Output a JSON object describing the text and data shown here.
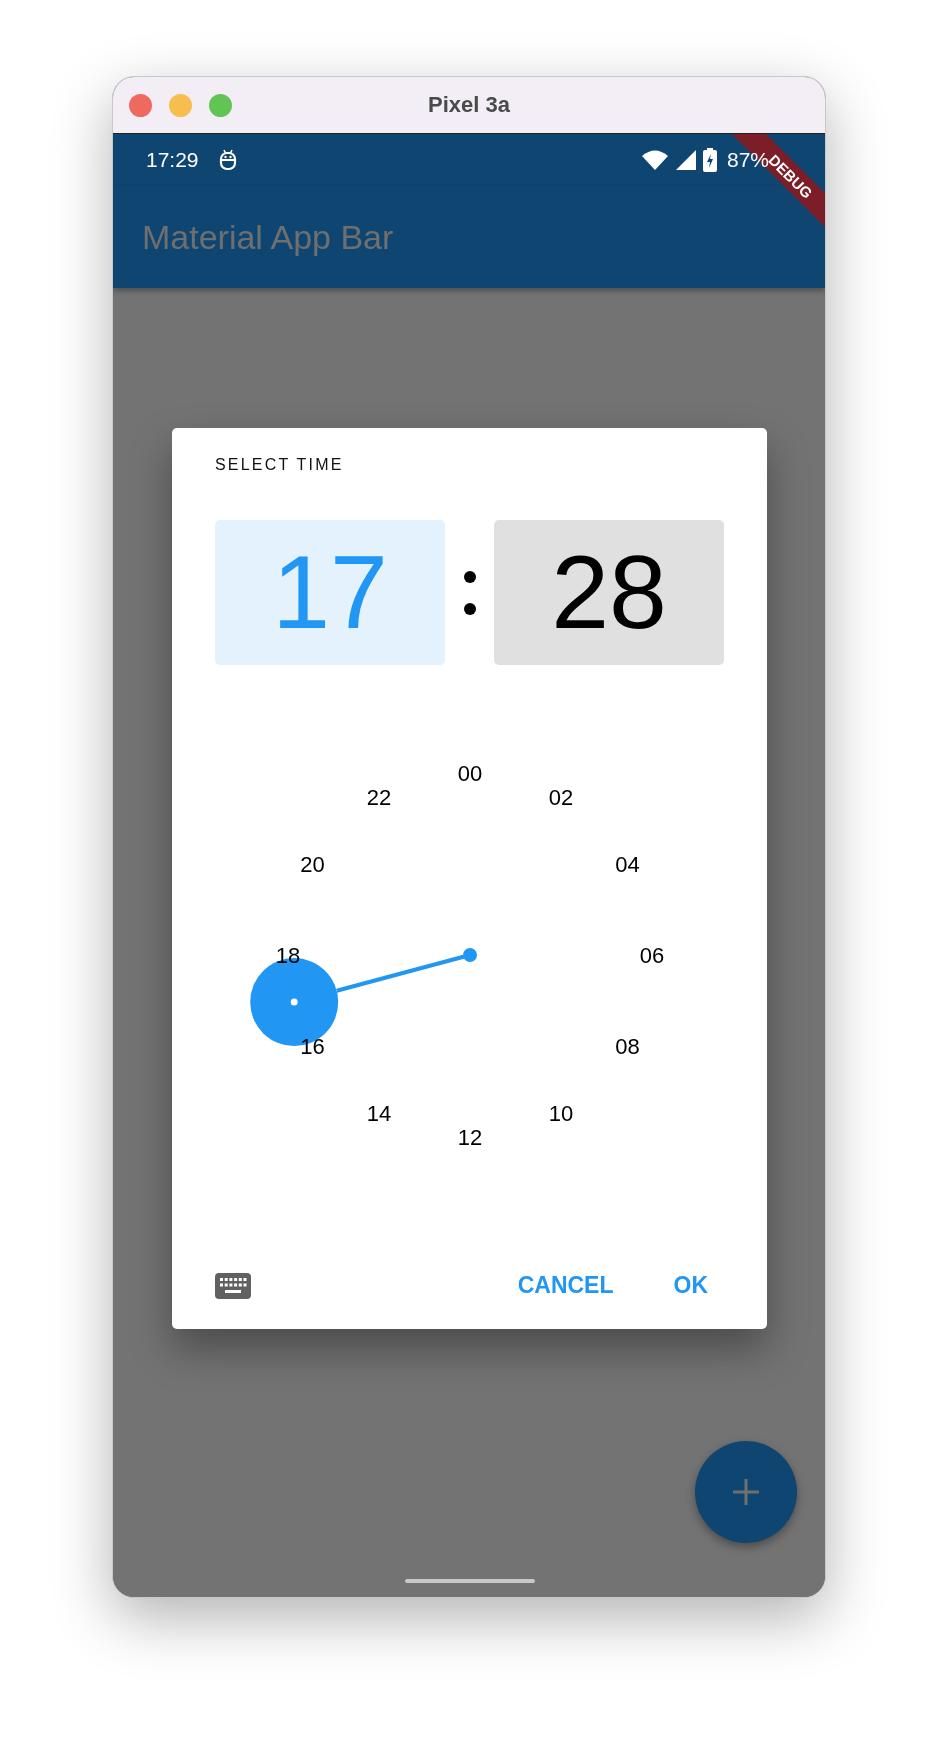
{
  "window": {
    "title": "Pixel 3a"
  },
  "status_bar": {
    "time": "17:29",
    "battery": "87%"
  },
  "debug_banner": {
    "label": "DEBUG"
  },
  "app_bar": {
    "title": "Material App Bar"
  },
  "dialog": {
    "title": "SELECT TIME",
    "hour": {
      "value": "17",
      "selected": true
    },
    "minute": {
      "value": "28",
      "selected": false
    },
    "dial": {
      "labels": [
        "00",
        "02",
        "04",
        "06",
        "08",
        "10",
        "12",
        "14",
        "16",
        "18",
        "20",
        "22"
      ]
    },
    "buttons": [
      "CANCEL",
      "OK"
    ]
  }
}
